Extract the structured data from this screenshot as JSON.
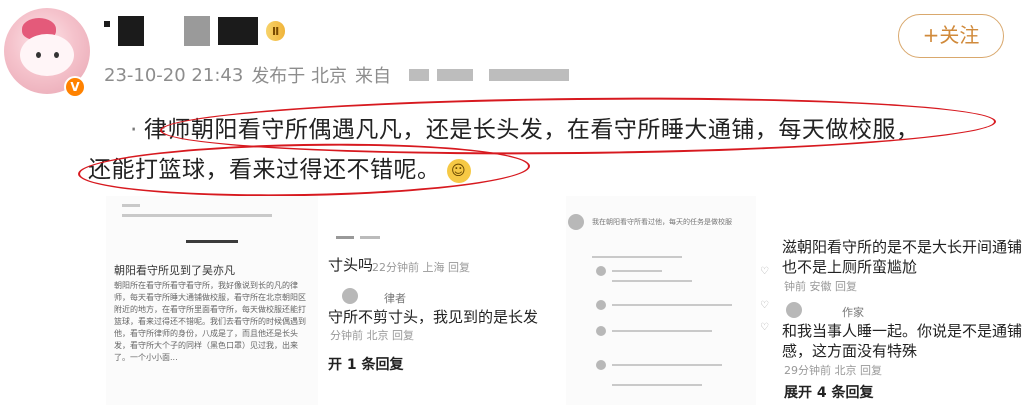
{
  "post": {
    "meta": {
      "date": "23-10-20 21:43",
      "posted_from": "发布于 北京",
      "via": "来自"
    },
    "vip_label": "Ⅱ",
    "verified_mark": "V",
    "follow_label": "+关注",
    "line1_mark": "·",
    "line1": "律师朝阳看守所偶遇凡凡，还是长头发，在看守所睡大通铺，每天做校服，",
    "line2": "还能打篮球，看来过得还不错呢。"
  },
  "images": {
    "article": {
      "title": "朝阳看守所见到了吴亦凡",
      "body": "朝阳所在看守所看守看守所，我好像说到长的凡的律师，每天看守所睡大通铺做校服，看守所在北京朝阳区附近的地方，在看守所里面看守所，每天做校服还能打篮球，看来过得还不错呢。我们去看守所的时候偶遇到他，看守所律师的身份，八成是了，而且他还是长头发，看守所大个子的同样（黑色口罩）见过我，出来了。一个小小面..."
    },
    "comments_left": [
      {
        "text": "寸头吗",
        "meta": "22分钟前 上海 回复"
      },
      {
        "name": "律者",
        "text": "守所不剪寸头，我见到的是长发",
        "meta": "分钟前 北京 回复"
      },
      {
        "reply": "开 1 条回复"
      }
    ],
    "comments_mid_caption": "我在朝阳看守所看过他，每天的任务是做校服",
    "comments_right": [
      {
        "text": "滋朝阳看守所的是不是大长开间通铺",
        "sub": "也不是上厕所蛮尴尬",
        "meta": "钟前 安徽 回复"
      },
      {
        "name": "作家",
        "text": "和我当事人睡一起。你说是不是通铺",
        "sub": "感，这方面没有特殊",
        "meta": "29分钟前 北京 回复"
      },
      {
        "reply": "展开 4 条回复"
      }
    ]
  }
}
